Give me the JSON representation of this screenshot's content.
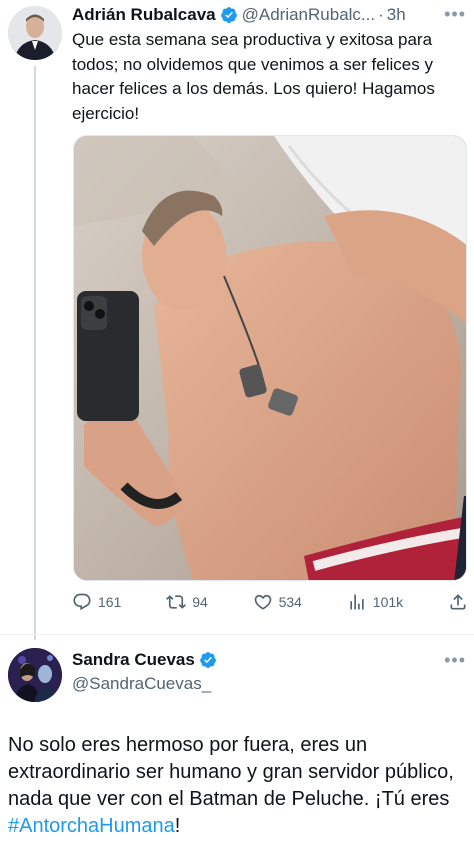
{
  "tweet1": {
    "author_name": "Adrián Rubalcava",
    "handle": "@AdrianRubalc...",
    "separator": "·",
    "time": "3h",
    "more": "•••",
    "text": "Que esta semana sea productiva y exitosa para todos; no olvidemos que venimos a ser felices y hacer felices a los demás. Los quiero! Hagamos ejercicio!",
    "actions": {
      "replies": "161",
      "retweets": "94",
      "likes": "534",
      "views": "101k"
    }
  },
  "tweet2": {
    "author_name": "Sandra Cuevas",
    "handle": "@SandraCuevas_",
    "more": "•••",
    "text_before": "No solo eres hermoso por fuera, eres un extraordinario ser humano y gran servidor público, nada que ver con el Batman de Peluche. ¡Tú eres ",
    "hashtag": "#AntorchaHumana",
    "text_after": "!"
  },
  "colors": {
    "verified": "#1d9bf0",
    "muted": "#536471",
    "hashtag": "#1d9bf0",
    "thread_line": "#cfd9de"
  }
}
